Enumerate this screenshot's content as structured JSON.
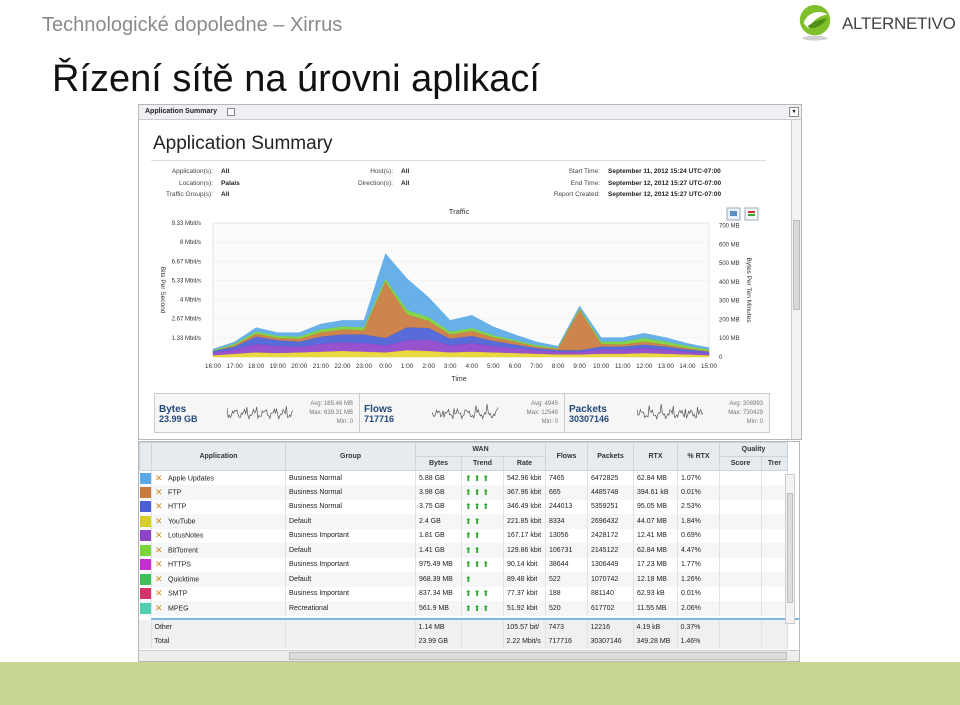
{
  "slide": {
    "subtitle": "Technologické dopoledne – Xirrus",
    "title": "Řízení sítě na úrovni aplikací",
    "logo_text": "ALTERNETIVO",
    "bottom_bar_color": "#c6d791"
  },
  "summary_panel": {
    "tab_label": "Application Summary",
    "heading": "Application Summary",
    "meta_left": [
      {
        "key": "Application(s):",
        "value": "All"
      },
      {
        "key": "Location(s):",
        "value": "Palais"
      },
      {
        "key": "Traffic Group(s):",
        "value": "All"
      }
    ],
    "meta_mid": [
      {
        "key": "Host(s):",
        "value": "All"
      },
      {
        "key": "Direction(s):",
        "value": "All"
      }
    ],
    "meta_right": [
      {
        "key": "Start Time:",
        "value": "September 11, 2012 15:24 UTC-07:00"
      },
      {
        "key": "End Time:",
        "value": "September 12, 2012 15:27 UTC-07:00"
      },
      {
        "key": "Report Created:",
        "value": "September 12, 2012 15:27 UTC-07:00"
      }
    ]
  },
  "chart_data": {
    "type": "area",
    "title": "Traffic",
    "xlabel": "Time",
    "ylabel": "Bits Per Second",
    "y2label": "Bytes Per Ten Minutes",
    "x_ticks": [
      "16:00",
      "17:00",
      "18:00",
      "19:00",
      "20:00",
      "21:00",
      "22:00",
      "23:00",
      "0:00",
      "1:00",
      "2:00",
      "3:00",
      "4:00",
      "5:00",
      "6:00",
      "7:00",
      "8:00",
      "9:00",
      "10:00",
      "11:00",
      "12:00",
      "13:00",
      "14:00",
      "15:00"
    ],
    "y_ticks": [
      "1.33 Mbit/s",
      "2.67 Mbit/s",
      "4 Mbit/s",
      "5.33 Mbit/s",
      "6.67 Mbit/s",
      "8 Mbit/s",
      "9.33 Mbit/s"
    ],
    "y2_ticks": [
      "0",
      "100 MB",
      "200 MB",
      "300 MB",
      "400 MB",
      "500 MB",
      "600 MB",
      "700 MB"
    ],
    "ylim": [
      0,
      9.33
    ],
    "y_unit": "Mbit/s",
    "x_range": [
      "16:00",
      "15:00"
    ],
    "series": [
      {
        "color": "#e8d531",
        "values": [
          0.1,
          0.2,
          0.3,
          0.25,
          0.3,
          0.35,
          0.4,
          0.35,
          0.3,
          0.45,
          0.4,
          0.3,
          0.35,
          0.3,
          0.25,
          0.2,
          0.15,
          0.15,
          0.2,
          0.2,
          0.25,
          0.2,
          0.15,
          0.1
        ]
      },
      {
        "color": "#8e44c9",
        "values": [
          0.2,
          0.3,
          0.6,
          0.5,
          0.4,
          0.55,
          0.6,
          0.6,
          0.5,
          0.7,
          0.8,
          0.5,
          0.6,
          0.45,
          0.35,
          0.25,
          0.2,
          0.2,
          0.3,
          0.3,
          0.35,
          0.3,
          0.2,
          0.15
        ]
      },
      {
        "color": "#4a5fd6",
        "values": [
          0.1,
          0.2,
          0.5,
          0.4,
          0.35,
          0.5,
          0.55,
          0.6,
          0.5,
          0.9,
          0.8,
          0.45,
          0.5,
          0.35,
          0.25,
          0.15,
          0.1,
          0.1,
          0.2,
          0.2,
          0.25,
          0.2,
          0.15,
          0.1
        ]
      },
      {
        "color": "#c97a3e",
        "values": [
          0.0,
          0.1,
          0.2,
          0.15,
          0.2,
          0.3,
          0.35,
          0.3,
          3.9,
          0.9,
          0.5,
          0.3,
          0.35,
          0.25,
          0.2,
          0.1,
          0.1,
          2.8,
          0.2,
          0.15,
          0.2,
          0.15,
          0.1,
          0.05
        ]
      },
      {
        "color": "#79d33a",
        "values": [
          0.05,
          0.1,
          0.15,
          0.15,
          0.15,
          0.2,
          0.2,
          0.2,
          0.2,
          0.3,
          0.25,
          0.2,
          0.2,
          0.15,
          0.1,
          0.1,
          0.05,
          0.1,
          0.15,
          0.2,
          0.25,
          0.2,
          0.15,
          0.1
        ]
      },
      {
        "color": "#5aa9e6",
        "values": [
          0.1,
          0.15,
          0.3,
          0.25,
          0.3,
          0.4,
          0.45,
          0.5,
          1.8,
          2.2,
          1.4,
          0.8,
          0.9,
          0.6,
          0.4,
          0.25,
          0.15,
          0.2,
          0.3,
          0.3,
          0.35,
          0.3,
          0.2,
          0.15
        ]
      }
    ]
  },
  "totals": [
    {
      "label": "Bytes",
      "value": "23.99 GB",
      "stats": [
        "Avg: 165.46 MB",
        "Max: 639.31 MB",
        "Min: 0"
      ]
    },
    {
      "label": "Flows",
      "value": "717716",
      "stats": [
        "Avg: 4945",
        "Max: 12548",
        "Min: 0"
      ]
    },
    {
      "label": "Packets",
      "value": "30307146",
      "stats": [
        "Avg: 208993",
        "Max: 730429",
        "Min: 0"
      ]
    }
  ],
  "table": {
    "headers": {
      "application": "Application",
      "group": "Group",
      "wan": "WAN",
      "bytes": "Bytes",
      "trend": "Trend",
      "rate": "Rate",
      "flows": "Flows",
      "packets": "Packets",
      "rtx": "RTX",
      "pct_rtx": "% RTX",
      "quality": "Quality",
      "score": "Score",
      "trend2": "Trer"
    },
    "rows": [
      {
        "color": "#5aa9e6",
        "app": "Apple Updates",
        "group": "Business Normal",
        "bytes": "5.88 GB",
        "arrows": 3,
        "rate": "542.96 kbit",
        "flows": "7465",
        "packets": "6472825",
        "rtx": "62.84 MB",
        "pct": "1.07%"
      },
      {
        "color": "#c97a3e",
        "app": "FTP",
        "group": "Business Normal",
        "bytes": "3.98 GB",
        "arrows": 3,
        "rate": "367.96 kbit",
        "flows": "665",
        "packets": "4485748",
        "rtx": "394.61 kB",
        "pct": "0.01%"
      },
      {
        "color": "#4a5fd6",
        "app": "HTTP",
        "group": "Business Normal",
        "bytes": "3.75 GB",
        "arrows": 3,
        "rate": "346.49 kbit",
        "flows": "244013",
        "packets": "5359251",
        "rtx": "95.05 MB",
        "pct": "2.53%"
      },
      {
        "color": "#d8cb2e",
        "app": "YouTube",
        "group": "Default",
        "bytes": "2.4 GB",
        "arrows": 2,
        "rate": "221.85 kbit",
        "flows": "8334",
        "packets": "2696432",
        "rtx": "44.07 MB",
        "pct": "1.84%"
      },
      {
        "color": "#8e44c9",
        "app": "LotusNotes",
        "group": "Business Important",
        "bytes": "1.81 GB",
        "arrows": 2,
        "rate": "167.17 kbit",
        "flows": "13056",
        "packets": "2428172",
        "rtx": "12.41 MB",
        "pct": "0.69%"
      },
      {
        "color": "#79d33a",
        "app": "BitTorrent",
        "group": "Default",
        "bytes": "1.41 GB",
        "arrows": 2,
        "rate": "129.86 kbit",
        "flows": "106731",
        "packets": "2145122",
        "rtx": "62.84 MB",
        "pct": "4.47%"
      },
      {
        "color": "#c42fd3",
        "app": "HTTPS",
        "group": "Business Important",
        "bytes": "975.49 MB",
        "arrows": 3,
        "rate": "90.14 kbit",
        "flows": "38644",
        "packets": "1306449",
        "rtx": "17.23 MB",
        "pct": "1.77%"
      },
      {
        "color": "#3fbf5a",
        "app": "Quicktime",
        "group": "Default",
        "bytes": "968.39 MB",
        "arrows": 1,
        "rate": "89.48 kbit",
        "flows": "522",
        "packets": "1070742",
        "rtx": "12.18 MB",
        "pct": "1.26%"
      },
      {
        "color": "#d6336e",
        "app": "SMTP",
        "group": "Business Important",
        "bytes": "837.34 MB",
        "arrows": 3,
        "rate": "77.37 kbit",
        "flows": "188",
        "packets": "881140",
        "rtx": "62.93 kB",
        "pct": "0.01%"
      },
      {
        "color": "#4fd0b0",
        "app": "MPEG",
        "group": "Recreational",
        "bytes": "561.9 MB",
        "arrows": 3,
        "rate": "51.92 kbit",
        "flows": "520",
        "packets": "617702",
        "rtx": "11.55 MB",
        "pct": "2.06%"
      }
    ],
    "footer": [
      {
        "app": "Other",
        "bytes": "1.14 MB",
        "rate": "105.57 bit/",
        "flows": "7473",
        "packets": "12216",
        "rtx": "4.19 kB",
        "pct": "0.37%"
      },
      {
        "app": "Total",
        "bytes": "23.99 GB",
        "rate": "2.22 Mbit/s",
        "flows": "717716",
        "packets": "30307146",
        "rtx": "349.28 MB",
        "pct": "1.46%"
      }
    ]
  }
}
